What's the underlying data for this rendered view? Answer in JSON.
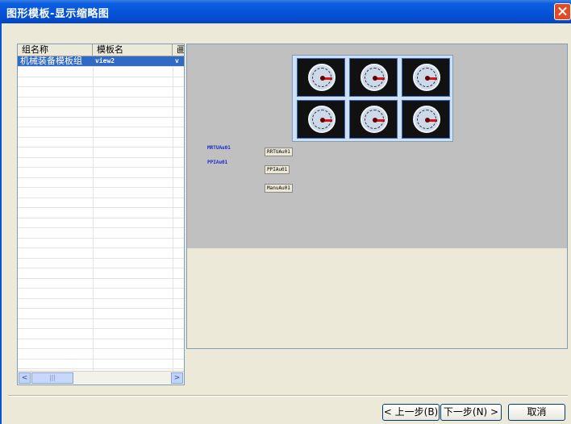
{
  "window": {
    "title": "图形模板-显示缩略图"
  },
  "list": {
    "columns": [
      "组名称",
      "模板名",
      "画"
    ],
    "rows": [
      {
        "group": "机械装备模板组",
        "template": "view2",
        "extra": "v"
      }
    ]
  },
  "scroll": {
    "left": "<",
    "right": ">",
    "thumb": "|||"
  },
  "preview": {
    "labels": [
      "MRTUAu01",
      "PPIAu01"
    ],
    "buttons": [
      "RRTUAu01",
      "PPIAu01",
      "ManuAu01"
    ]
  },
  "footer": {
    "prev": "< 上一步(B)",
    "next": "下一步(N) >",
    "cancel": "取消"
  }
}
